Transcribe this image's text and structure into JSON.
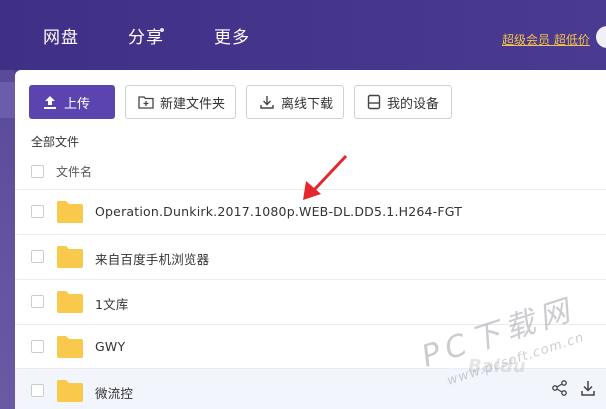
{
  "nav": {
    "items": [
      {
        "label": "网盘"
      },
      {
        "label": "分享"
      },
      {
        "label": "更多"
      }
    ],
    "vip_text": "超级会员 超低价"
  },
  "toolbar": {
    "upload": "上传",
    "new_folder": "新建文件夹",
    "offline_download": "离线下载",
    "my_devices": "我的设备"
  },
  "breadcrumb": "全部文件",
  "table": {
    "column_name": "文件名",
    "rows": [
      {
        "name": "Operation.Dunkirk.2017.1080p.WEB-DL.DD5.1.H264-FGT",
        "icon": "folder-icon"
      },
      {
        "name": "来自百度手机浏览器",
        "icon": "folder-icon"
      },
      {
        "name": "1文库",
        "icon": "folder-icon"
      },
      {
        "name": "GWY",
        "icon": "folder-icon"
      },
      {
        "name": "微流控",
        "icon": "folder-icon"
      }
    ]
  },
  "watermark": {
    "main": "PC下载网",
    "url": "www.pcsoft.com.cn",
    "faint": "Baidu"
  },
  "colors": {
    "header_bg": "#3f2f86",
    "accent": "#5b44b0",
    "vip": "#f3c348",
    "folder": "#f8c94a",
    "annotation_arrow": "#e5262d"
  }
}
